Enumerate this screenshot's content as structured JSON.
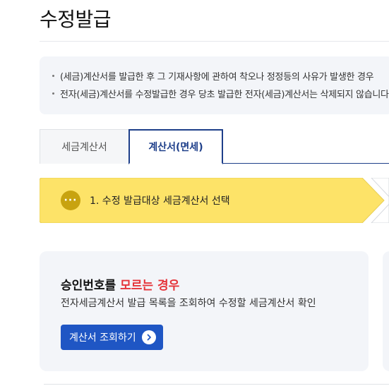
{
  "page": {
    "title": "수정발급"
  },
  "notice": {
    "lines": [
      "(세금)계산서를 발급한 후 그 기재사항에 관하여 착오나 정정등의 사유가 발생한 경우",
      "전자(세금)계산서를 수정발급한 경우 당초 발급한 전자(세금)계산서는 삭제되지 않습니다"
    ]
  },
  "tabs": [
    {
      "label": "세금계산서",
      "active": false
    },
    {
      "label": "계산서(면세)",
      "active": true
    }
  ],
  "step": {
    "badge": "···",
    "label": "1. 수정 발급대상 세금계산서 선택"
  },
  "card": {
    "title_prefix": "승인번호를 ",
    "title_accent": "모르는 경우",
    "description": "전자세금계산서 발급 목록을 조회하여 수정할 세금계산서 확인",
    "button_label": "계산서 조회하기"
  },
  "colors": {
    "primary": "#1e3f8a",
    "button": "#1f56c4",
    "accent_red": "#e5343a",
    "step_yellow": "#fde368",
    "panel_bg": "#f3f5f9"
  },
  "icons": {
    "step_badge": "more-dots-icon",
    "button": "chevron-right-circle-icon"
  }
}
